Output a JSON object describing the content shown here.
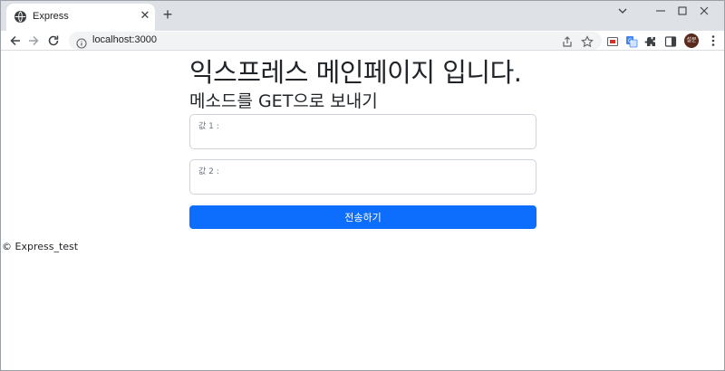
{
  "browser": {
    "tab_title": "Express",
    "tab_close": "✕",
    "new_tab": "+",
    "url": "localhost:3000",
    "avatar_text": "설문",
    "icons": {
      "favicon": "globe-icon",
      "back": "back-arrow-icon",
      "forward": "forward-arrow-icon",
      "reload": "reload-icon",
      "site_info": "info-icon",
      "share": "share-icon",
      "bookmark": "star-icon",
      "extensions": "puzzle-icon",
      "side_panel": "side-panel-icon",
      "menu": "kebab-menu-icon"
    }
  },
  "page": {
    "title": "익스프레스 메인페이지 입니다.",
    "subtitle": "메소드를 GET으로 보내기",
    "field1": {
      "label": "값 1 :",
      "value": ""
    },
    "field2": {
      "label": "값 2 :",
      "value": ""
    },
    "submit_label": "전송하기",
    "footer": "© Express_test"
  },
  "colors": {
    "primary": "#0d6efd",
    "tabstrip": "#dee1e6",
    "omnibox": "#f1f3f4"
  }
}
